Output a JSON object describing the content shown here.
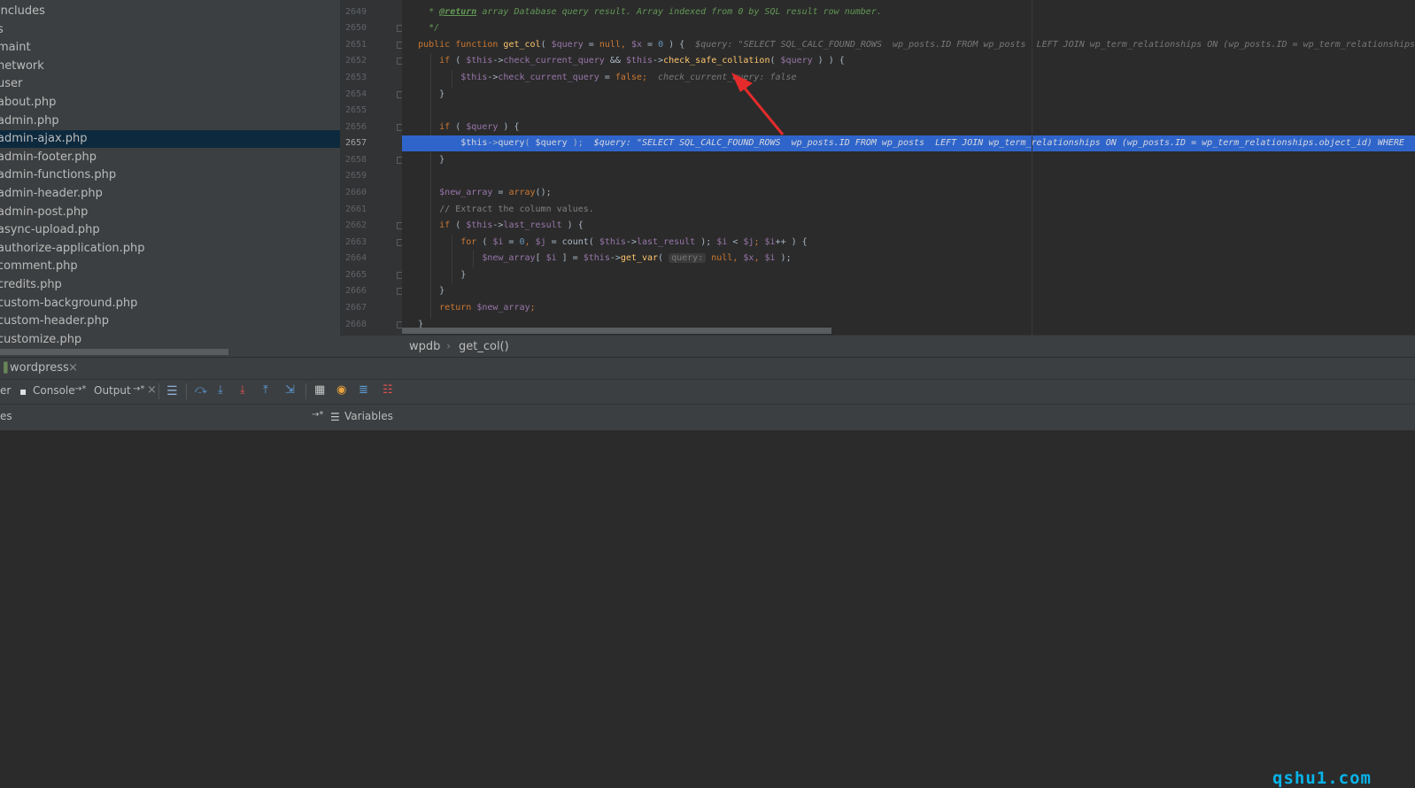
{
  "project_tree": {
    "items": [
      "includes",
      "s",
      "maint",
      "network",
      "user",
      "about.php",
      "admin.php",
      "admin-ajax.php",
      "admin-footer.php",
      "admin-functions.php",
      "admin-header.php",
      "admin-post.php",
      "async-upload.php",
      "authorize-application.php",
      "comment.php",
      "credits.php",
      "custom-background.php",
      "custom-header.php",
      "customize.php"
    ],
    "selected_item": "admin-ajax.php"
  },
  "editor": {
    "line_numbers": [
      "2649",
      "2650",
      "2651",
      "2652",
      "2653",
      "2654",
      "2655",
      "2656",
      "2657",
      "2658",
      "2659",
      "2660",
      "2661",
      "2662",
      "2663",
      "2664",
      "2665",
      "2666",
      "2667",
      "2668"
    ],
    "current_line": "2657",
    "code": {
      "l2649": {
        "star": "* ",
        "tag": "@return",
        "text": " array Database query result. Array indexed from 0 by SQL result row number."
      },
      "l2650": {
        "text": "*/"
      },
      "l2651": {
        "kw1": "public",
        "kw2": "function",
        "name": "get_col",
        "p1": "( ",
        "v1": "$query",
        "eq1": " = ",
        "null1": "null",
        "comma": ", ",
        "v2": "$x",
        "eq2": " = ",
        "zero": "0",
        "p2": " ) {",
        "inline_var": "$query:",
        "inline_value": "\"SELECT SQL_CALC_FOUND_ROWS  wp_posts.ID FROM wp_posts  LEFT JOIN wp_term_relationships ON (wp_posts.ID = wp_term_relationships.object_id) WHERE"
      },
      "l2652": {
        "kw": "if",
        "p1": " ( ",
        "this1": "$this",
        "arrow1": "->",
        "prop": "check_current_query",
        "and": " && ",
        "this2": "$this",
        "arrow2": "->",
        "method": "check_safe_collation",
        "p2": "( ",
        "v": "$query",
        "p3": " ) ) {"
      },
      "l2653": {
        "this": "$this",
        "arrow": "->",
        "prop": "check_current_query",
        "eq": " = ",
        "val": "false",
        "semi": ";",
        "inline_value": "check_current_query: false"
      },
      "l2654": {
        "text": "}"
      },
      "l2656": {
        "kw": "if",
        "p1": " ( ",
        "v": "$query",
        "p2": " ) {"
      },
      "l2657": {
        "this": "$this",
        "arrow": "->",
        "method": "query",
        "p1": "( ",
        "v": "$query",
        "p2": " );",
        "inline_var": "$query:",
        "inline_value": "\"SELECT SQL_CALC_FOUND_ROWS  wp_posts.ID FROM wp_posts  LEFT JOIN wp_term_relationships ON (wp_posts.ID = wp_term_relationships.object_id) WHERE"
      },
      "l2658": {
        "text": "}"
      },
      "l2660": {
        "v": "$new_array",
        "eq": " = ",
        "kw": "array",
        "rest": "();"
      },
      "l2661": {
        "text": "// Extract the column values."
      },
      "l2662": {
        "kw": "if",
        "p1": " ( ",
        "this": "$this",
        "arrow": "->",
        "prop": "last_result",
        "p2": " ) {"
      },
      "l2663": {
        "kw": "for",
        "p1": " ( ",
        "i1": "$i",
        "eq1": " = ",
        "zero": "0",
        "c1": ", ",
        "j1": "$j",
        "eq2": " = ",
        "count": "count",
        "p2": "( ",
        "this": "$this",
        "arrow": "->",
        "prop": "last_result",
        "p3": " ); ",
        "i2": "$i",
        "lt": " < ",
        "j2": "$j",
        "semi": "; ",
        "i3": "$i",
        "inc": "++ ) {"
      },
      "l2664": {
        "v": "$new_array",
        "b1": "[ ",
        "i": "$i",
        "b2": " ] = ",
        "this": "$this",
        "arrow": "->",
        "method": "get_var",
        "p1": "( ",
        "hint": "query:",
        "null": "null",
        "c1": ", ",
        "x": "$x",
        "c2": ", ",
        "i2": "$i",
        "p2": " );"
      },
      "l2665": {
        "text": "}"
      },
      "l2666": {
        "text": "}"
      },
      "l2667": {
        "kw": "return",
        "v": "$new_array",
        "semi": ";"
      },
      "l2668": {
        "text": "}"
      }
    }
  },
  "breadcrumb": {
    "class_name": "wpdb",
    "separator": "›",
    "method_name": "get_col()"
  },
  "debug_session": {
    "name": "wordpress",
    "close": "×"
  },
  "debug_tabs": {
    "first_partial": "er",
    "console": "Console",
    "console_pin": "→*",
    "output": "Output",
    "output_pin": "→*",
    "close": "×"
  },
  "debug_panels": {
    "frames_partial": "es",
    "pin": "→*",
    "variables": "Variables"
  },
  "watermark": "qshu1.com",
  "colors": {
    "selection": "#2f65ca",
    "annotation_arrow": "#e52b2b",
    "watermark": "#08b4ea"
  }
}
